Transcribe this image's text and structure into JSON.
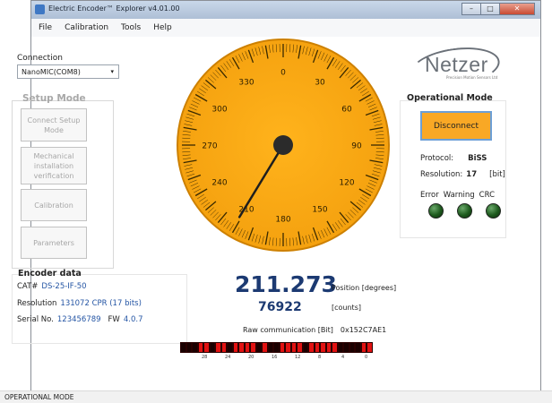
{
  "window": {
    "title": "Electric Encoder™ Explorer v4.01.00",
    "min": "–",
    "max": "□",
    "close": "✕"
  },
  "menu": [
    "File",
    "Calibration",
    "Tools",
    "Help"
  ],
  "connection": {
    "label": "Connection",
    "value": "NanoMIC(COM8)",
    "arrow": "▾"
  },
  "setup_mode": {
    "title": "Setup Mode",
    "buttons": [
      "Connect Setup Mode",
      "Mechanical installation verification",
      "Calibration",
      "Parameters"
    ]
  },
  "logo": {
    "word": "Netzer",
    "tagline": "Precision Motion Sensors Ltd"
  },
  "operational_mode": {
    "title": "Operational Mode",
    "button": "Disconnect",
    "protocol_label": "Protocol:",
    "protocol_value": "BiSS",
    "resolution_label": "Resolution:",
    "resolution_value": "17",
    "resolution_unit": "[bit]",
    "led_labels": [
      "Error",
      "Warning",
      "CRC"
    ]
  },
  "gauge": {
    "labels": [
      "0",
      "30",
      "60",
      "90",
      "120",
      "150",
      "180",
      "210",
      "240",
      "270",
      "300",
      "330"
    ],
    "angle_deg": 211.273
  },
  "encoder_data": {
    "title": "Encoder data",
    "cat_label": "CAT#",
    "cat_value": "DS-25-IF-50",
    "resolution_label": "Resolution",
    "resolution_value": "131072 CPR (17 bits)",
    "serial_label": "Serial No.",
    "serial_value": "123456789",
    "fw_label": "FW",
    "fw_value": "4.0.7"
  },
  "position": {
    "value": "211.273",
    "unit": "Position [degrees]",
    "counts": "76922",
    "counts_unit": "[counts]"
  },
  "raw": {
    "label": "Raw communication [Bit]",
    "hex": "0x152C7AE1",
    "bits": [
      1,
      1,
      1,
      0,
      0,
      1,
      0,
      0,
      1,
      0,
      0,
      0,
      0,
      1,
      0,
      1,
      1,
      0,
      0,
      0,
      0,
      1,
      0,
      0,
      0,
      0,
      0,
      1,
      1,
      1,
      1,
      0,
      0
    ],
    "bit_labels": [
      "28",
      "24",
      "20",
      "16",
      "12",
      "8",
      "4",
      "0"
    ],
    "colors": {
      "on": "#1a0000",
      "off": "#e21212"
    }
  },
  "status": "OPERATIONAL MODE"
}
